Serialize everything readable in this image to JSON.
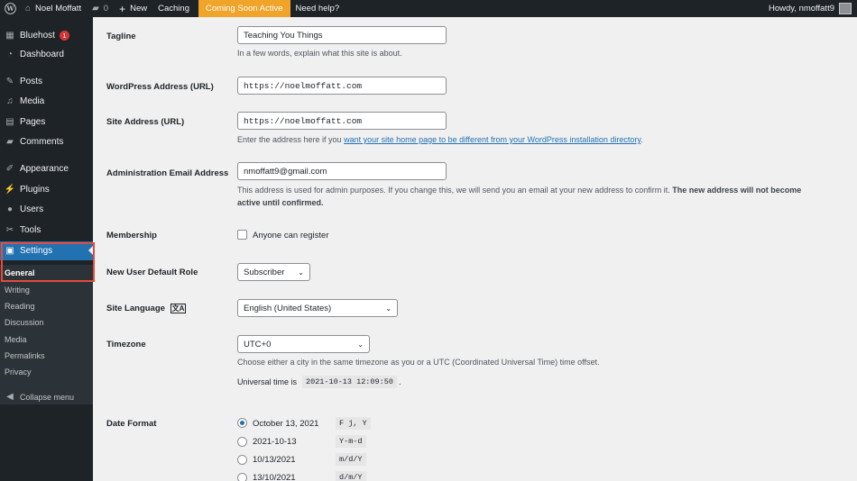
{
  "admin_bar": {
    "site_name": "Noel Moffatt",
    "comments_count": "0",
    "new_label": "New",
    "caching_label": "Caching",
    "coming_soon_label": "Coming Soon Active",
    "help_label": "Need help?",
    "greeting": "Howdy, nmoffatt9"
  },
  "sidebar": {
    "items": [
      {
        "label": "Bluehost",
        "icon": "grid-icon",
        "badge": "1"
      },
      {
        "label": "Dashboard",
        "icon": "dashboard-icon"
      },
      {
        "label": "Posts",
        "icon": "pin-icon"
      },
      {
        "label": "Media",
        "icon": "media-icon"
      },
      {
        "label": "Pages",
        "icon": "pages-icon"
      },
      {
        "label": "Comments",
        "icon": "comments-icon"
      },
      {
        "label": "Appearance",
        "icon": "brush-icon"
      },
      {
        "label": "Plugins",
        "icon": "plug-icon"
      },
      {
        "label": "Users",
        "icon": "users-icon"
      },
      {
        "label": "Tools",
        "icon": "wrench-icon"
      },
      {
        "label": "Settings",
        "icon": "settings-icon"
      }
    ],
    "submenu": [
      "General",
      "Writing",
      "Reading",
      "Discussion",
      "Media",
      "Permalinks",
      "Privacy"
    ],
    "collapse_label": "Collapse menu",
    "active_color": "#2271b1",
    "highlight_color": "#e54b3a"
  },
  "form": {
    "tagline": {
      "label": "Tagline",
      "value": "Teaching You Things",
      "description": "In a few words, explain what this site is about."
    },
    "wp_address": {
      "label": "WordPress Address (URL)",
      "value": "https://noelmoffatt.com"
    },
    "site_address": {
      "label": "Site Address (URL)",
      "value": "https://noelmoffatt.com",
      "description_prefix": "Enter the address here if you ",
      "description_link": "want your site home page to be different from your WordPress installation directory",
      "description_suffix": "."
    },
    "admin_email": {
      "label": "Administration Email Address",
      "value": "nmoffatt9@gmail.com",
      "description_line1": "This address is used for admin purposes. If you change this, we will send you an email at your new address to confirm it. ",
      "description_bold1": "The new address will not become",
      "description_bold2": "active until confirmed."
    },
    "membership": {
      "label": "Membership",
      "checkbox_label": "Anyone can register",
      "checked": false
    },
    "default_role": {
      "label": "New User Default Role",
      "value": "Subscriber"
    },
    "site_language": {
      "label": "Site Language",
      "value": "English (United States)"
    },
    "timezone": {
      "label": "Timezone",
      "value": "UTC+0",
      "description": "Choose either a city in the same timezone as you or a UTC (Coordinated Universal Time) time offset.",
      "universal_prefix": "Universal time is",
      "universal_time": "2021-10-13 12:09:50",
      "universal_suffix": "."
    },
    "date_format": {
      "label": "Date Format",
      "options": [
        {
          "label": "October 13, 2021",
          "code": "F j, Y",
          "checked": true
        },
        {
          "label": "2021-10-13",
          "code": "Y-m-d",
          "checked": false
        },
        {
          "label": "10/13/2021",
          "code": "m/d/Y",
          "checked": false
        },
        {
          "label": "13/10/2021",
          "code": "d/m/Y",
          "checked": false
        }
      ]
    }
  }
}
